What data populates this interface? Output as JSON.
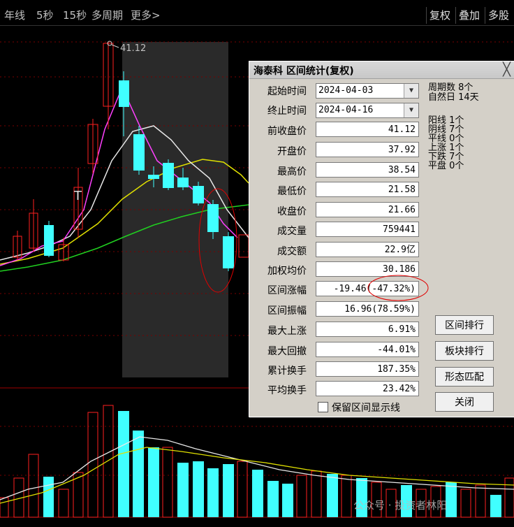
{
  "toolbar": {
    "left": [
      "年线",
      "5秒",
      "15秒",
      "多周期",
      "更多>"
    ],
    "right": [
      "复权",
      "叠加",
      "多股"
    ]
  },
  "chart": {
    "high_label": "41.12",
    "t_marker": "T"
  },
  "dialog": {
    "title": "海泰科 区间统计(复权)",
    "close": "╳",
    "start_label": "起始时间",
    "start_value": "2024-04-03",
    "end_label": "终止时间",
    "end_value": "2024-04-16",
    "rows": [
      {
        "label": "前收盘价",
        "value": "41.12"
      },
      {
        "label": "开盘价",
        "value": "37.92"
      },
      {
        "label": "最高价",
        "value": "38.54"
      },
      {
        "label": "最低价",
        "value": "21.58"
      },
      {
        "label": "收盘价",
        "value": "21.66"
      },
      {
        "label": "成交量",
        "value": "759441"
      },
      {
        "label": "成交额",
        "value": "22.9亿"
      },
      {
        "label": "加权均价",
        "value": "30.186"
      },
      {
        "label": "区间涨幅",
        "value": "-19.46(-47.32%)"
      },
      {
        "label": "区间振幅",
        "value": "16.96(78.59%)"
      },
      {
        "label": "最大上涨",
        "value": "6.91%"
      },
      {
        "label": "最大回撤",
        "value": "-44.01%"
      },
      {
        "label": "累计换手",
        "value": "187.35%"
      },
      {
        "label": "平均换手",
        "value": "23.42%"
      }
    ],
    "stats": {
      "period_count": "周期数 8个",
      "natural_days": "自然日 14天",
      "yang": "阳线 1个",
      "yin": "阴线 7个",
      "ping_line": "平线 0个",
      "up": "上涨 1个",
      "down": "下跌 7个",
      "flat": "平盘 0个"
    },
    "buttons": [
      "区间排行",
      "板块排行",
      "形态匹配",
      "关闭"
    ],
    "checkbox_label": "保留区间显示线"
  },
  "watermark": "公众号 · 投资者林阳",
  "colors": {
    "up": "#ff2020",
    "down": "#40ffff",
    "ma_white": "#e8e8e8",
    "ma_magenta": "#ff40ff",
    "ma_yellow": "#e0e000",
    "ma_green": "#20d020"
  }
}
